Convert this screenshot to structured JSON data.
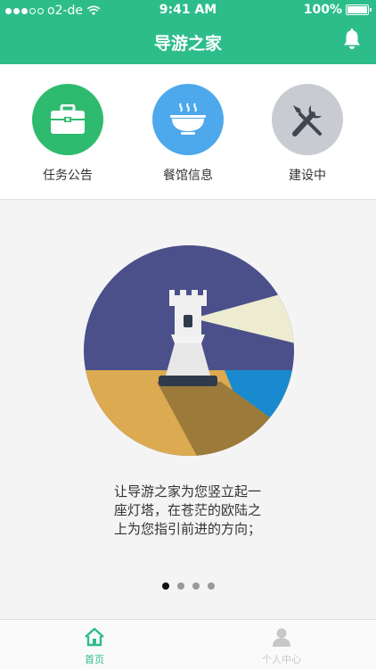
{
  "status_bar": {
    "carrier": "o2-de",
    "time": "9:41 AM",
    "battery": "100%"
  },
  "header": {
    "title": "导游之家",
    "bell_icon": "bell-icon"
  },
  "menu": [
    {
      "label": "任务公告",
      "icon": "briefcase-icon",
      "color": "#2fbb6f"
    },
    {
      "label": "餐馆信息",
      "icon": "bowl-icon",
      "color": "#4da8ec"
    },
    {
      "label": "建设中",
      "icon": "tools-icon",
      "color": "#c8ccd2"
    }
  ],
  "slide": {
    "text": "让导游之家为您竖立起一座灯塔，在苍茫的欧陆之上为您指引前进的方向；",
    "page_count": 4,
    "active_page": 1
  },
  "tabbar": {
    "tabs": [
      {
        "label": "首页",
        "icon": "home-icon",
        "active": true
      },
      {
        "label": "个人中心",
        "icon": "person-icon",
        "active": false
      }
    ]
  },
  "colors": {
    "brand": "#2dbd8a",
    "tab_inactive": "#c7c7c7"
  }
}
